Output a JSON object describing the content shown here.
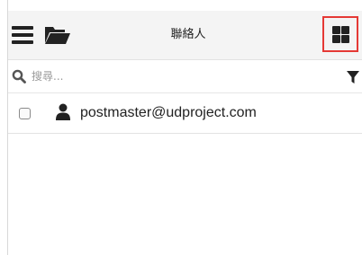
{
  "header": {
    "title": "聯絡人",
    "menu_icon": "hamburger-menu-icon",
    "folder_icon": "folder-open-icon",
    "view_toggle_icon": "grid-view-icon",
    "highlight_color": "#e53935"
  },
  "search": {
    "placeholder": "搜尋...",
    "value": "",
    "search_icon": "search-icon",
    "filter_icon": "filter-icon"
  },
  "contacts": [
    {
      "email": "postmaster@udproject.com",
      "checked": false,
      "icon": "user-icon"
    }
  ]
}
